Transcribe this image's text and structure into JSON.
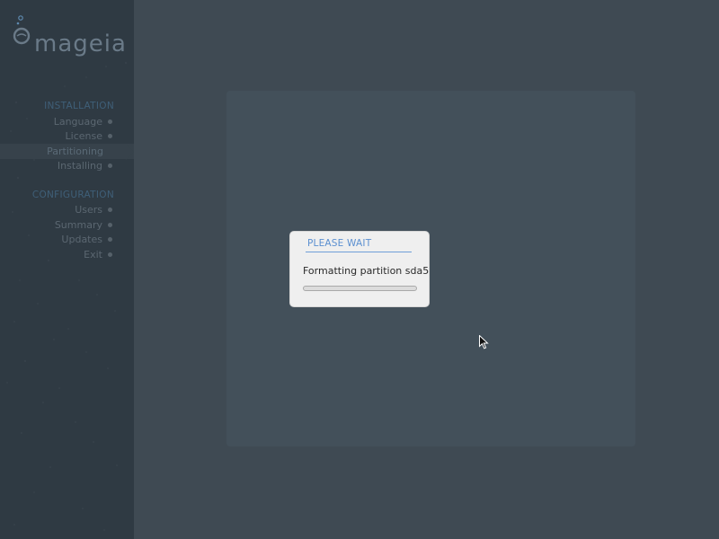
{
  "logo": {
    "text": "mageia"
  },
  "sidebar": {
    "sections": [
      {
        "heading": "INSTALLATION",
        "steps": [
          {
            "label": "Language"
          },
          {
            "label": "License"
          },
          {
            "label": "Partitioning",
            "active": true
          },
          {
            "label": "Installing"
          }
        ]
      },
      {
        "heading": "CONFIGURATION",
        "steps": [
          {
            "label": "Users"
          },
          {
            "label": "Summary"
          },
          {
            "label": "Updates"
          },
          {
            "label": "Exit"
          }
        ]
      }
    ]
  },
  "dialog": {
    "title": "PLEASE WAIT",
    "message": "Formatting partition sda5",
    "progress": 0
  },
  "colors": {
    "background": "#3f4a53",
    "sidebar": "#2f3a43",
    "panel": "#43505a",
    "accent": "#5a8fd0"
  },
  "icons": {
    "cursor": "arrow-cursor-icon",
    "logo": "mageia-logo-icon"
  }
}
